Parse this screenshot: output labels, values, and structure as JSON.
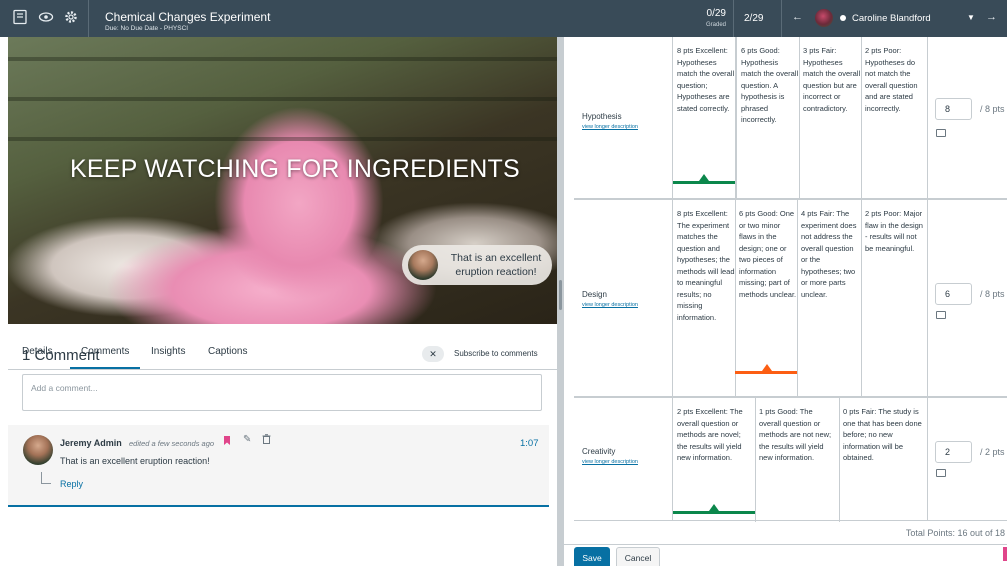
{
  "header": {
    "title": "Chemical Changes Experiment",
    "due": "Due: No Due Date - PHYSCI",
    "graded_count": "0/29",
    "graded_label": "Graded",
    "student_index": "2/29",
    "student_name": "Caroline Blandford",
    "icons": [
      "gradebook-icon",
      "eye-icon",
      "settings-icon",
      "prev-arrow-icon",
      "chevron-down-icon",
      "next-arrow-icon"
    ]
  },
  "media": {
    "caption": "KEEP WATCHING FOR INGREDIENTS",
    "bubble_text": "That is an excellent eruption reaction!"
  },
  "tabs": [
    "Details",
    "Comments",
    "Insights",
    "Captions"
  ],
  "comments": {
    "count_label": "1 Comment",
    "subscribe_label": "Subscribe to comments",
    "placeholder": "Add a comment...",
    "items": [
      {
        "author": "Jeremy Admin",
        "meta": "edited a few seconds ago",
        "time": "1:07",
        "text": "That is an excellent eruption reaction!",
        "reply": "Reply"
      }
    ]
  },
  "rubric": {
    "link_label": "view longer description",
    "criteria": [
      {
        "name": "Hypothesis",
        "ratings": [
          "8 pts Excellent: Hypotheses match the overall question; Hypotheses are stated correctly.",
          "6 pts Good: Hypothesis match the overall question. A hypothesis is phrased incorrectly.",
          "3 pts Fair: Hypotheses match the overall question but are incorrect or contradictory.",
          "2 pts Poor: Hypotheses do not match the overall question and are stated incorrectly."
        ],
        "selected": 0,
        "selected_color": "#0b874b",
        "score": "8",
        "max": "/ 8 pts"
      },
      {
        "name": "Design",
        "ratings": [
          "8 pts Excellent: The experiment matches the question and hypotheses; the methods will lead to meaningful results; no missing information.",
          "6 pts Good: One or two minor flaws in the design; one or two pieces of information missing; part of methods unclear.",
          "4 pts Fair: The experiment does not address the overall question or the hypotheses; two or more parts unclear.",
          "2 pts Poor: Major flaw in the design - results will not be meaningful."
        ],
        "selected": 1,
        "selected_color": "#fc5e13",
        "score": "6",
        "max": "/ 8 pts"
      },
      {
        "name": "Creativity",
        "ratings": [
          "2 pts Excellent: The overall question or methods are novel; the results will yield new information.",
          "1 pts Good: The overall question or methods are not new; the results will yield new information.",
          "0 pts Fair: The study is one that has been done before; no new information will be obtained."
        ],
        "selected": 0,
        "selected_color": "#0b874b",
        "score": "2",
        "max": "/ 2 pts"
      }
    ],
    "total": "Total Points: 16 out of 18"
  },
  "actions": {
    "save": "Save",
    "cancel": "Cancel"
  }
}
